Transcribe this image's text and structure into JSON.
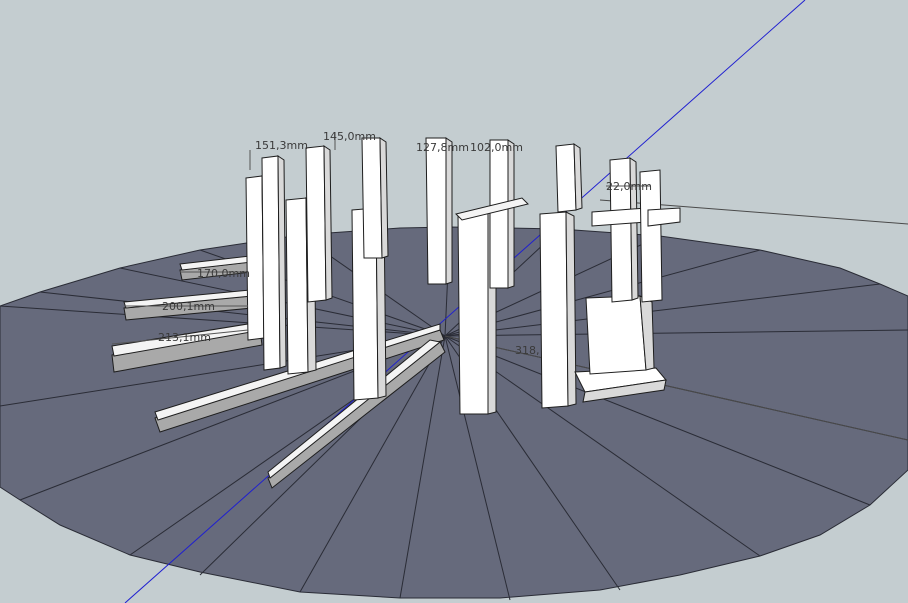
{
  "viewport": {
    "background_color": "#c4cdd0",
    "ground_color": "#666a7c",
    "axis_color": "#1f1fd0"
  },
  "dimensions": [
    {
      "id": "dim-151",
      "text": "151,3mm"
    },
    {
      "id": "dim-145",
      "text": "145,0mm"
    },
    {
      "id": "dim-127",
      "text": "127,8mm"
    },
    {
      "id": "dim-102",
      "text": "102,0mm"
    },
    {
      "id": "dim-22",
      "text": "22,0mm"
    },
    {
      "id": "dim-170",
      "text": "170,0mm"
    },
    {
      "id": "dim-200",
      "text": "200,1mm"
    },
    {
      "id": "dim-213",
      "text": "213,1mm"
    },
    {
      "id": "dim-318",
      "text": "318,"
    }
  ]
}
